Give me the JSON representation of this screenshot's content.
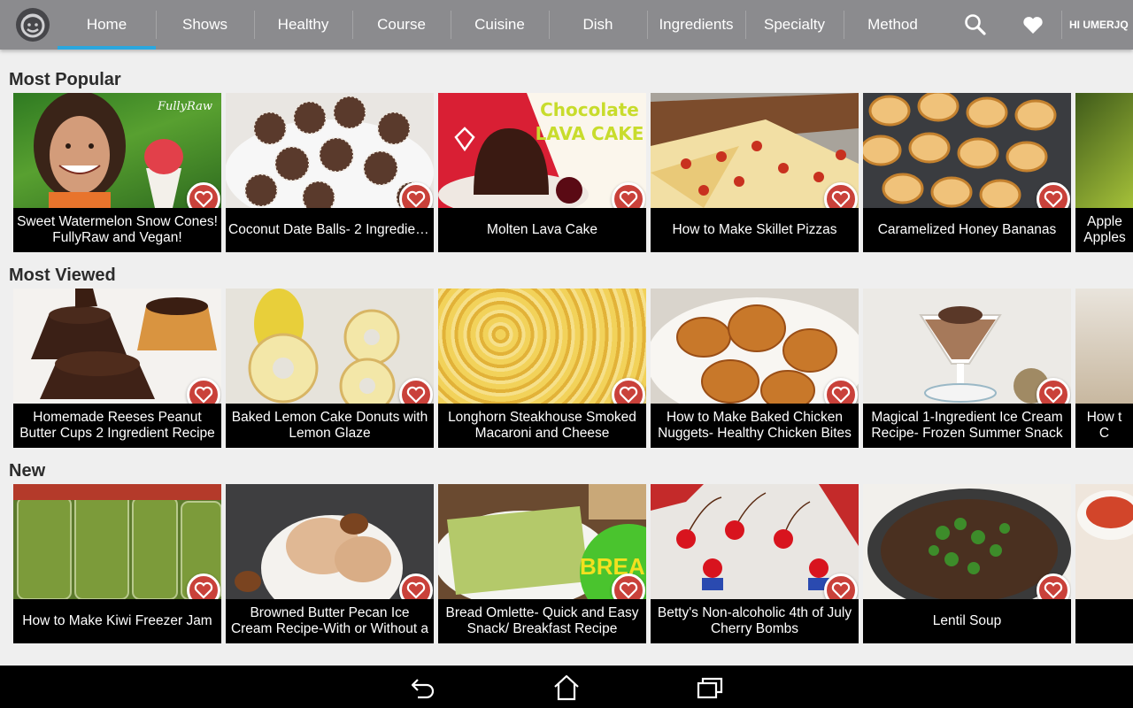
{
  "app": {
    "user_label": "HI UMERJQ"
  },
  "tabs": [
    "Home",
    "Shows",
    "Healthy",
    "Course",
    "Cuisine",
    "Dish",
    "Ingredients",
    "Specialty",
    "Method"
  ],
  "active_tab": "Home",
  "colors": {
    "appbar": "#8b8b8e",
    "accent": "#2aa7df",
    "favorite": "#c9413a"
  },
  "icons": {
    "search": "search-icon",
    "favorites": "heart-icon",
    "logo": "smiley-logo-icon"
  },
  "sections": [
    {
      "title": "Most Popular",
      "cards": [
        {
          "title": "Sweet Watermelon Snow Cones! FullyRaw and Vegan!",
          "overlay": "FullyRaw"
        },
        {
          "title": "Coconut Date Balls- 2 Ingredient…"
        },
        {
          "title": "Molten Lava Cake",
          "overlay": "Chocolate LAVA CAKE"
        },
        {
          "title": "How to Make Skillet Pizzas"
        },
        {
          "title": "Caramelized Honey Bananas"
        },
        {
          "title": "Apple Apples"
        }
      ]
    },
    {
      "title": "Most Viewed",
      "cards": [
        {
          "title": "Homemade Reeses Peanut Butter Cups 2 Ingredient Recipe"
        },
        {
          "title": "Baked Lemon Cake Donuts with Lemon Glaze"
        },
        {
          "title": "Longhorn Steakhouse Smoked Macaroni and Cheese"
        },
        {
          "title": "How to Make Baked Chicken Nuggets- Healthy Chicken Bites"
        },
        {
          "title": "Magical 1-Ingredient Ice Cream Recipe- Frozen Summer Snack"
        },
        {
          "title": "How t C"
        }
      ]
    },
    {
      "title": "New",
      "cards": [
        {
          "title": "How to Make Kiwi Freezer Jam"
        },
        {
          "title": "Browned Butter Pecan Ice Cream Recipe-With or Without a"
        },
        {
          "title": "Bread Omlette- Quick and Easy Snack/ Breakfast Recipe",
          "overlay": "BREA"
        },
        {
          "title": "Betty's Non-alcoholic 4th of July Cherry Bombs"
        },
        {
          "title": "Lentil Soup"
        },
        {
          "title": ""
        }
      ]
    }
  ],
  "system_nav": [
    "back",
    "home",
    "recent-apps"
  ]
}
